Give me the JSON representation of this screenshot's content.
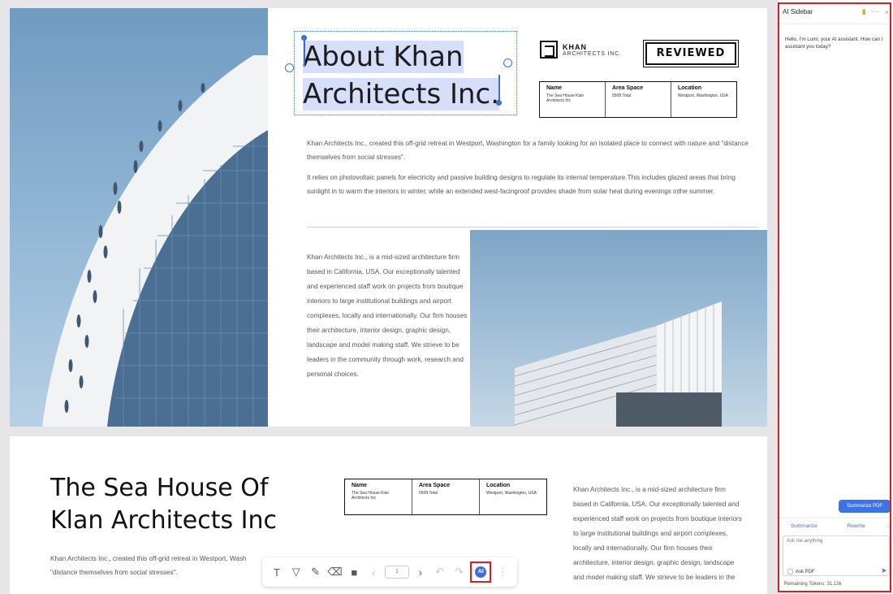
{
  "document": {
    "page1": {
      "title_line1": "About Khan",
      "title_line2": "Architects Inc.",
      "logo_name": "KHAN",
      "logo_sub": "ARCHITECTS INC.",
      "stamp": "REVIEWED",
      "info_table": {
        "headers": [
          "Name",
          "Area Space",
          "Location"
        ],
        "values": [
          "The Sea House Klan Architects Inc",
          "550ft Total",
          "Westport, Washington, USA"
        ]
      },
      "paragraph1": "Khan Architects Inc., created this off-grid retreat in Westport, Washington for a family looking for an isolated place to connect with nature and \"distance themselves from social stresses\".",
      "paragraph2": "It relies on photovoltaic panels for electricity and passive building designs to regulate its internal temperature.This includes glazed areas that bring sunlight in to warm the interiors in winter, while an extended west-facingroof provides shade from solar heat during evenings inthe summer.",
      "paragraph3": "Khan Architects Inc., is a mid-sized architecture firm based in California, USA. Our exceptionally talented and experienced staff work on projects from boutique interiors to large institutional buildings and airport complexes, locally and internationally. Our firm houses their architecture, interior design, graphic design, landscape and model making staff. We strieve to be leaders in the community through work, research and personal choices."
    },
    "page2": {
      "title_line1": "The Sea House Of",
      "title_line2": "Klan Architects Inc",
      "info_table": {
        "headers": [
          "Name",
          "Area Space",
          "Location"
        ],
        "values": [
          "The Sea House Klan Architects Inc",
          "550ft Total",
          "Westport, Washington, USA"
        ]
      },
      "paragraph_left": "Khan Architects Inc., created this off-grid retreat in Westport, Wash \"distance themselves from social stresses\".",
      "paragraph_right": "Khan Architects Inc., is a mid-sized architecture firm based in California, USA. Our exceptionally talented and experienced staff work on projects from boutique interiors to large institutional buildings and airport complexes, locally and internationally. Our firm houses their architecture, interior design, graphic design, landscape and model making staff. We strieve to be leaders in the"
    }
  },
  "toolbar": {
    "page_indicator": "1",
    "icons": [
      "text-tool-icon",
      "highlighter-icon",
      "pen-icon",
      "eraser-icon",
      "shape-icon",
      "prev-page-icon",
      "next-page-icon",
      "undo-icon",
      "redo-icon",
      "ai-assistant-icon",
      "more-icon"
    ],
    "ai_label": "AI"
  },
  "sidebar": {
    "title": "AI Sidebar",
    "greeting": "Hello, I'm Lumi, your AI assistant. How can I assistant you today?",
    "summarize_pdf": "Summarize PDF",
    "actions": [
      "Summarize",
      "Rewrite"
    ],
    "input_placeholder": "Ask me anything",
    "ask_pdf_label": "Ask PDF",
    "tokens": "Remaining Tokens: 31.13k"
  },
  "colors": {
    "selection": "#3d6fd1",
    "highlight_outline": "#d81f26",
    "accent": "#3d73e6"
  }
}
